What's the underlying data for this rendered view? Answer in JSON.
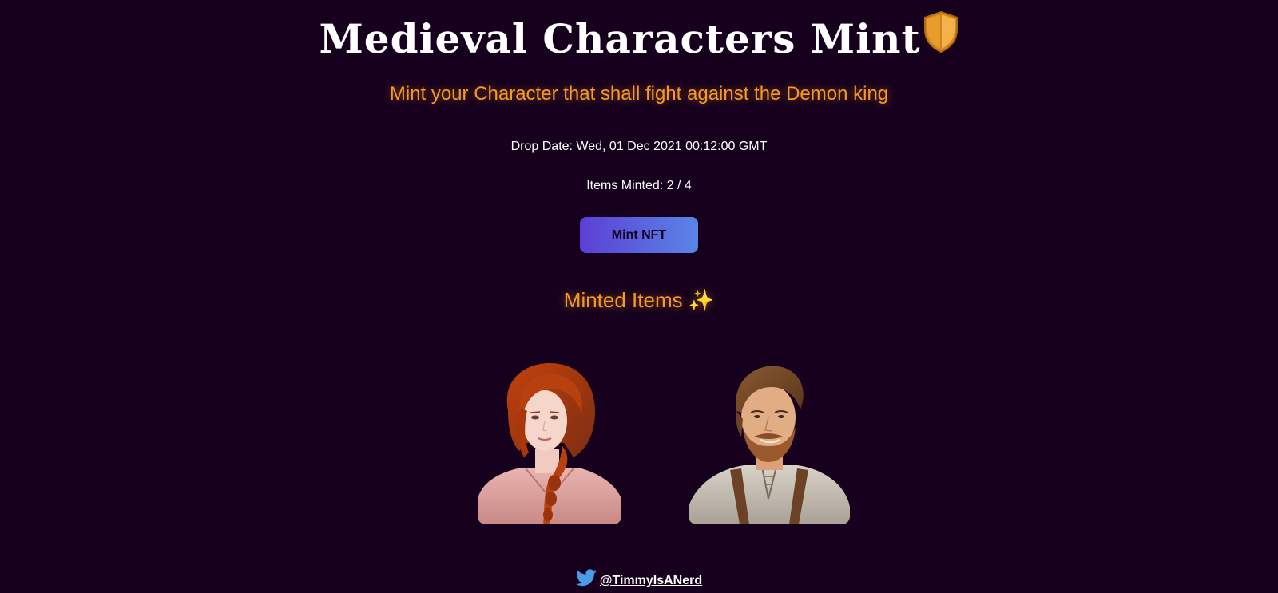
{
  "header": {
    "title": "Medieval Characters Mint",
    "title_icon": "shield-icon",
    "subtitle": "Mint your Character that shall fight against the Demon king"
  },
  "mint_info": {
    "drop_date": "Drop Date: Wed, 01 Dec 2021 00:12:00 GMT",
    "items_minted": "Items Minted: 2 / 4",
    "mint_button_label": "Mint NFT"
  },
  "minted_section": {
    "heading": "Minted Items ✨",
    "items": [
      {
        "character": "red-haired-woman-portrait"
      },
      {
        "character": "bearded-man-portrait"
      }
    ]
  },
  "footer": {
    "icon": "twitter-icon",
    "handle": "@TimmyIsANerd"
  },
  "colors": {
    "background": "#16001e",
    "accent_orange": "#f59a23",
    "button_gradient_start": "#5b3fd6",
    "button_gradient_end": "#5a85e5",
    "twitter_blue": "#4a9be8"
  }
}
